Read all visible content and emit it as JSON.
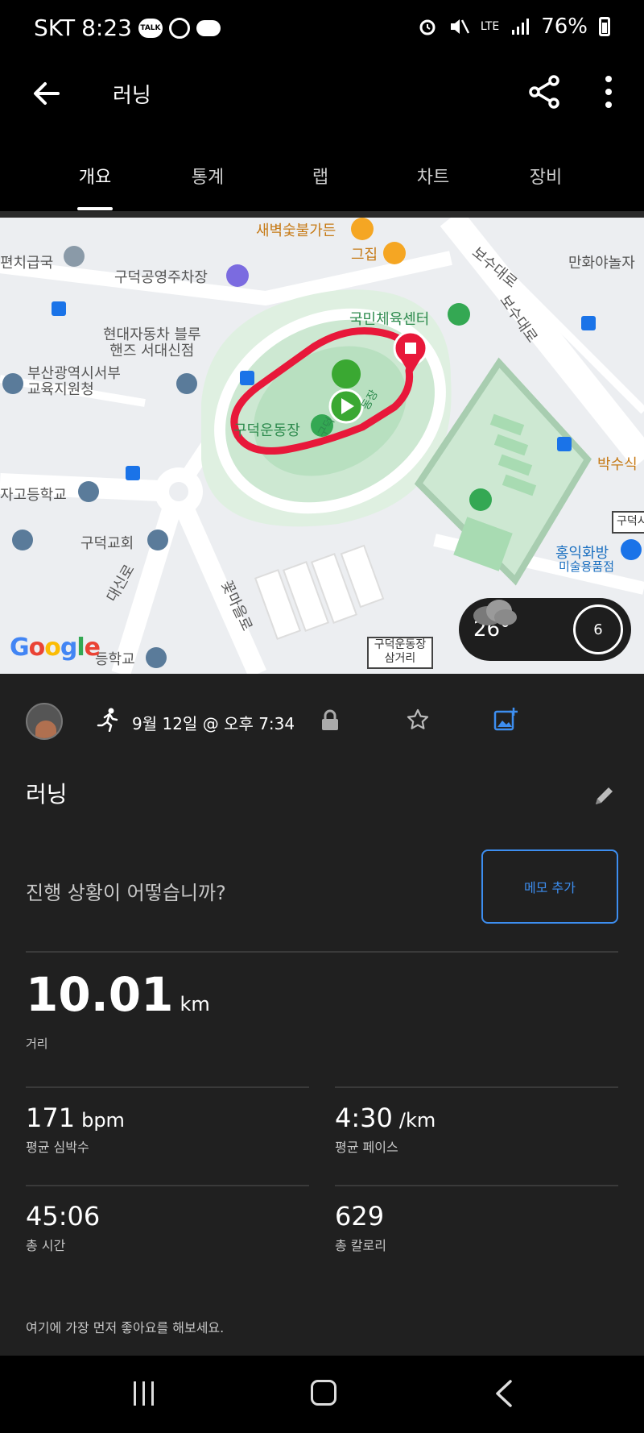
{
  "status_bar": {
    "carrier": "SKT",
    "time": "8:23",
    "talk_badge": "TALK",
    "network": "LTE",
    "battery": "76%"
  },
  "app_bar": {
    "title": "러닝"
  },
  "tabs": [
    {
      "label": "개요",
      "active": true
    },
    {
      "label": "통계",
      "active": false
    },
    {
      "label": "랩",
      "active": false
    },
    {
      "label": "차트",
      "active": false
    },
    {
      "label": "장비",
      "active": false
    }
  ],
  "map": {
    "labels": {
      "restaurant1": "새벽숯불가든",
      "restaurant2": "그집",
      "post_office": "편치급국",
      "parking": "구덕공영주차장",
      "road1": "보수대로",
      "road2": "보수대로",
      "comic": "만화야놀자",
      "gym": "국민체육센터",
      "hyundai": "현대자동차 블루\n핸즈 서대신점",
      "edu_office": "부산광역시서부\n교육지원청",
      "stadium": "구덕운동장",
      "track_label_left": "구덕",
      "track_label_right": "동장",
      "school1": "자고등학교",
      "church": "구덕교회",
      "road3": "대신로",
      "road4": "꽃마을로",
      "hongik": "홍익화방",
      "art_store": "미술용품점",
      "bus_right": "박수식",
      "school2": "등학교",
      "sign": "구덕운동장\n삼거리",
      "sign_right": "구덕시",
      "google": "Google"
    },
    "weather": {
      "temperature": "26°",
      "uv_index": "6"
    },
    "colors": {
      "route": "#e8183a",
      "start_pin": "#3aa832",
      "end_pin": "#e8183a"
    }
  },
  "activity": {
    "date": "9월 12일 @ 오후 7:34",
    "title": "러닝",
    "prompt": "진행 상황이 어떻습니까?",
    "memo_button": "메모 추가",
    "distance": {
      "value": "10.01",
      "unit": "km",
      "label": "거리"
    },
    "heart_rate": {
      "value": "171",
      "unit": "bpm",
      "label": "평균 심박수"
    },
    "pace": {
      "value": "4:30",
      "unit": "/km",
      "label": "평균 페이스"
    },
    "total_time": {
      "value": "45:06",
      "label": "총 시간"
    },
    "calories": {
      "value": "629",
      "label": "총 칼로리"
    },
    "like_prompt": "여기에 가장 먼저 좋아요를 해보세요."
  }
}
